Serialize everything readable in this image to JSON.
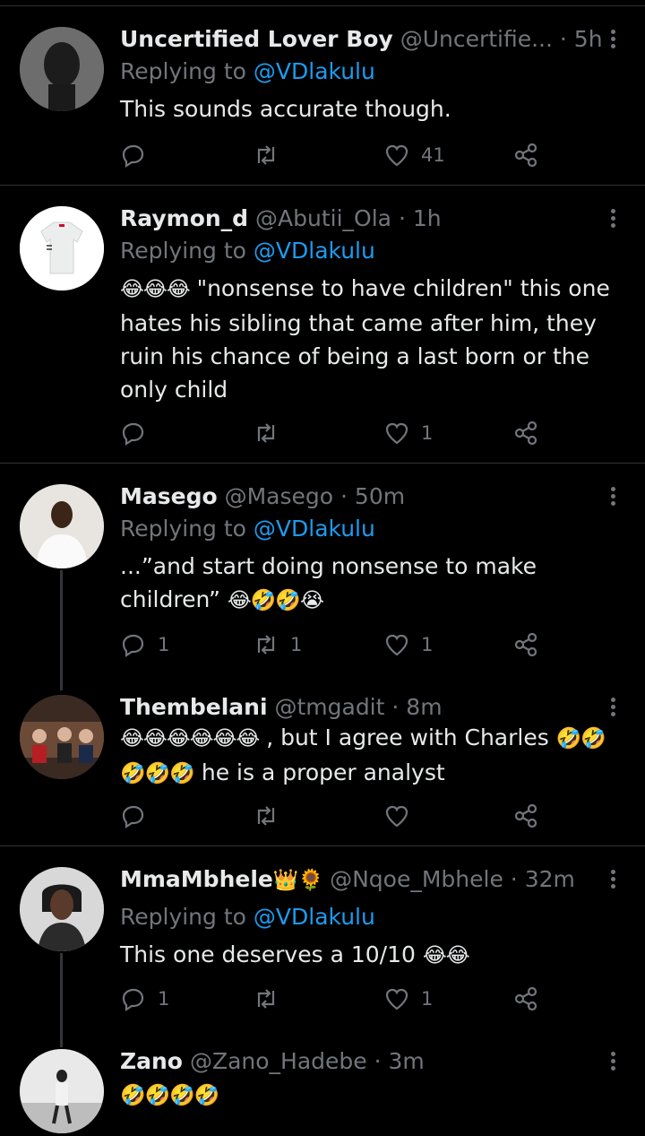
{
  "colors": {
    "background": "#000000",
    "text": "#e7e9ea",
    "muted": "#71767b",
    "link": "#1d9bf0",
    "divider": "#2f3336"
  },
  "tweets": [
    {
      "name": "Uncertified Lover Boy",
      "handle": "@Uncertifie...",
      "time": "· 5h",
      "replying_prefix": "Replying to ",
      "replying_handle": "@VDlakulu",
      "text": "This sounds accurate though.",
      "replies": "",
      "retweets": "",
      "likes": "41"
    },
    {
      "name": "Raymon_d",
      "handle": "@Abutii_Ola",
      "time": "· 1h",
      "replying_prefix": "Replying to ",
      "replying_handle": "@VDlakulu",
      "emoji": "😂😂😂",
      "text": " \"nonsense to have children\" this one hates his sibling that came after him, they ruin his chance of being a last born or the only child",
      "replies": "",
      "retweets": "",
      "likes": "1"
    },
    {
      "name": "Masego",
      "handle": "@Masego",
      "time": "· 50m",
      "replying_prefix": "Replying to ",
      "replying_handle": "@VDlakulu",
      "text": "...”and start doing nonsense to make children” ",
      "emoji": "😂🤣🤣😭",
      "replies": "1",
      "retweets": "1",
      "likes": "1"
    },
    {
      "name": "Thembelani",
      "handle": "@tmgadit",
      "time": "· 8m",
      "emoji": "😂😂😂😂😂😂",
      "text": " , but I agree with Charles ",
      "emoji2": "🤣🤣🤣🤣🤣",
      "text2": " he is a proper analyst",
      "replies": "",
      "retweets": "",
      "likes": ""
    },
    {
      "name": "MmaMbhele",
      "name_emoji": "👑🌻",
      "handle": "@Nqoe_Mbhele",
      "time": "· 32m",
      "replying_prefix": "Replying to ",
      "replying_handle": "@VDlakulu",
      "text": "This one deserves a 10/10 ",
      "emoji": "😂😂",
      "replies": "1",
      "retweets": "",
      "likes": "1"
    },
    {
      "name": "Zano",
      "handle": "@Zano_Hadebe",
      "time": "· 3m",
      "emoji": "🤣🤣🤣🤣"
    }
  ]
}
